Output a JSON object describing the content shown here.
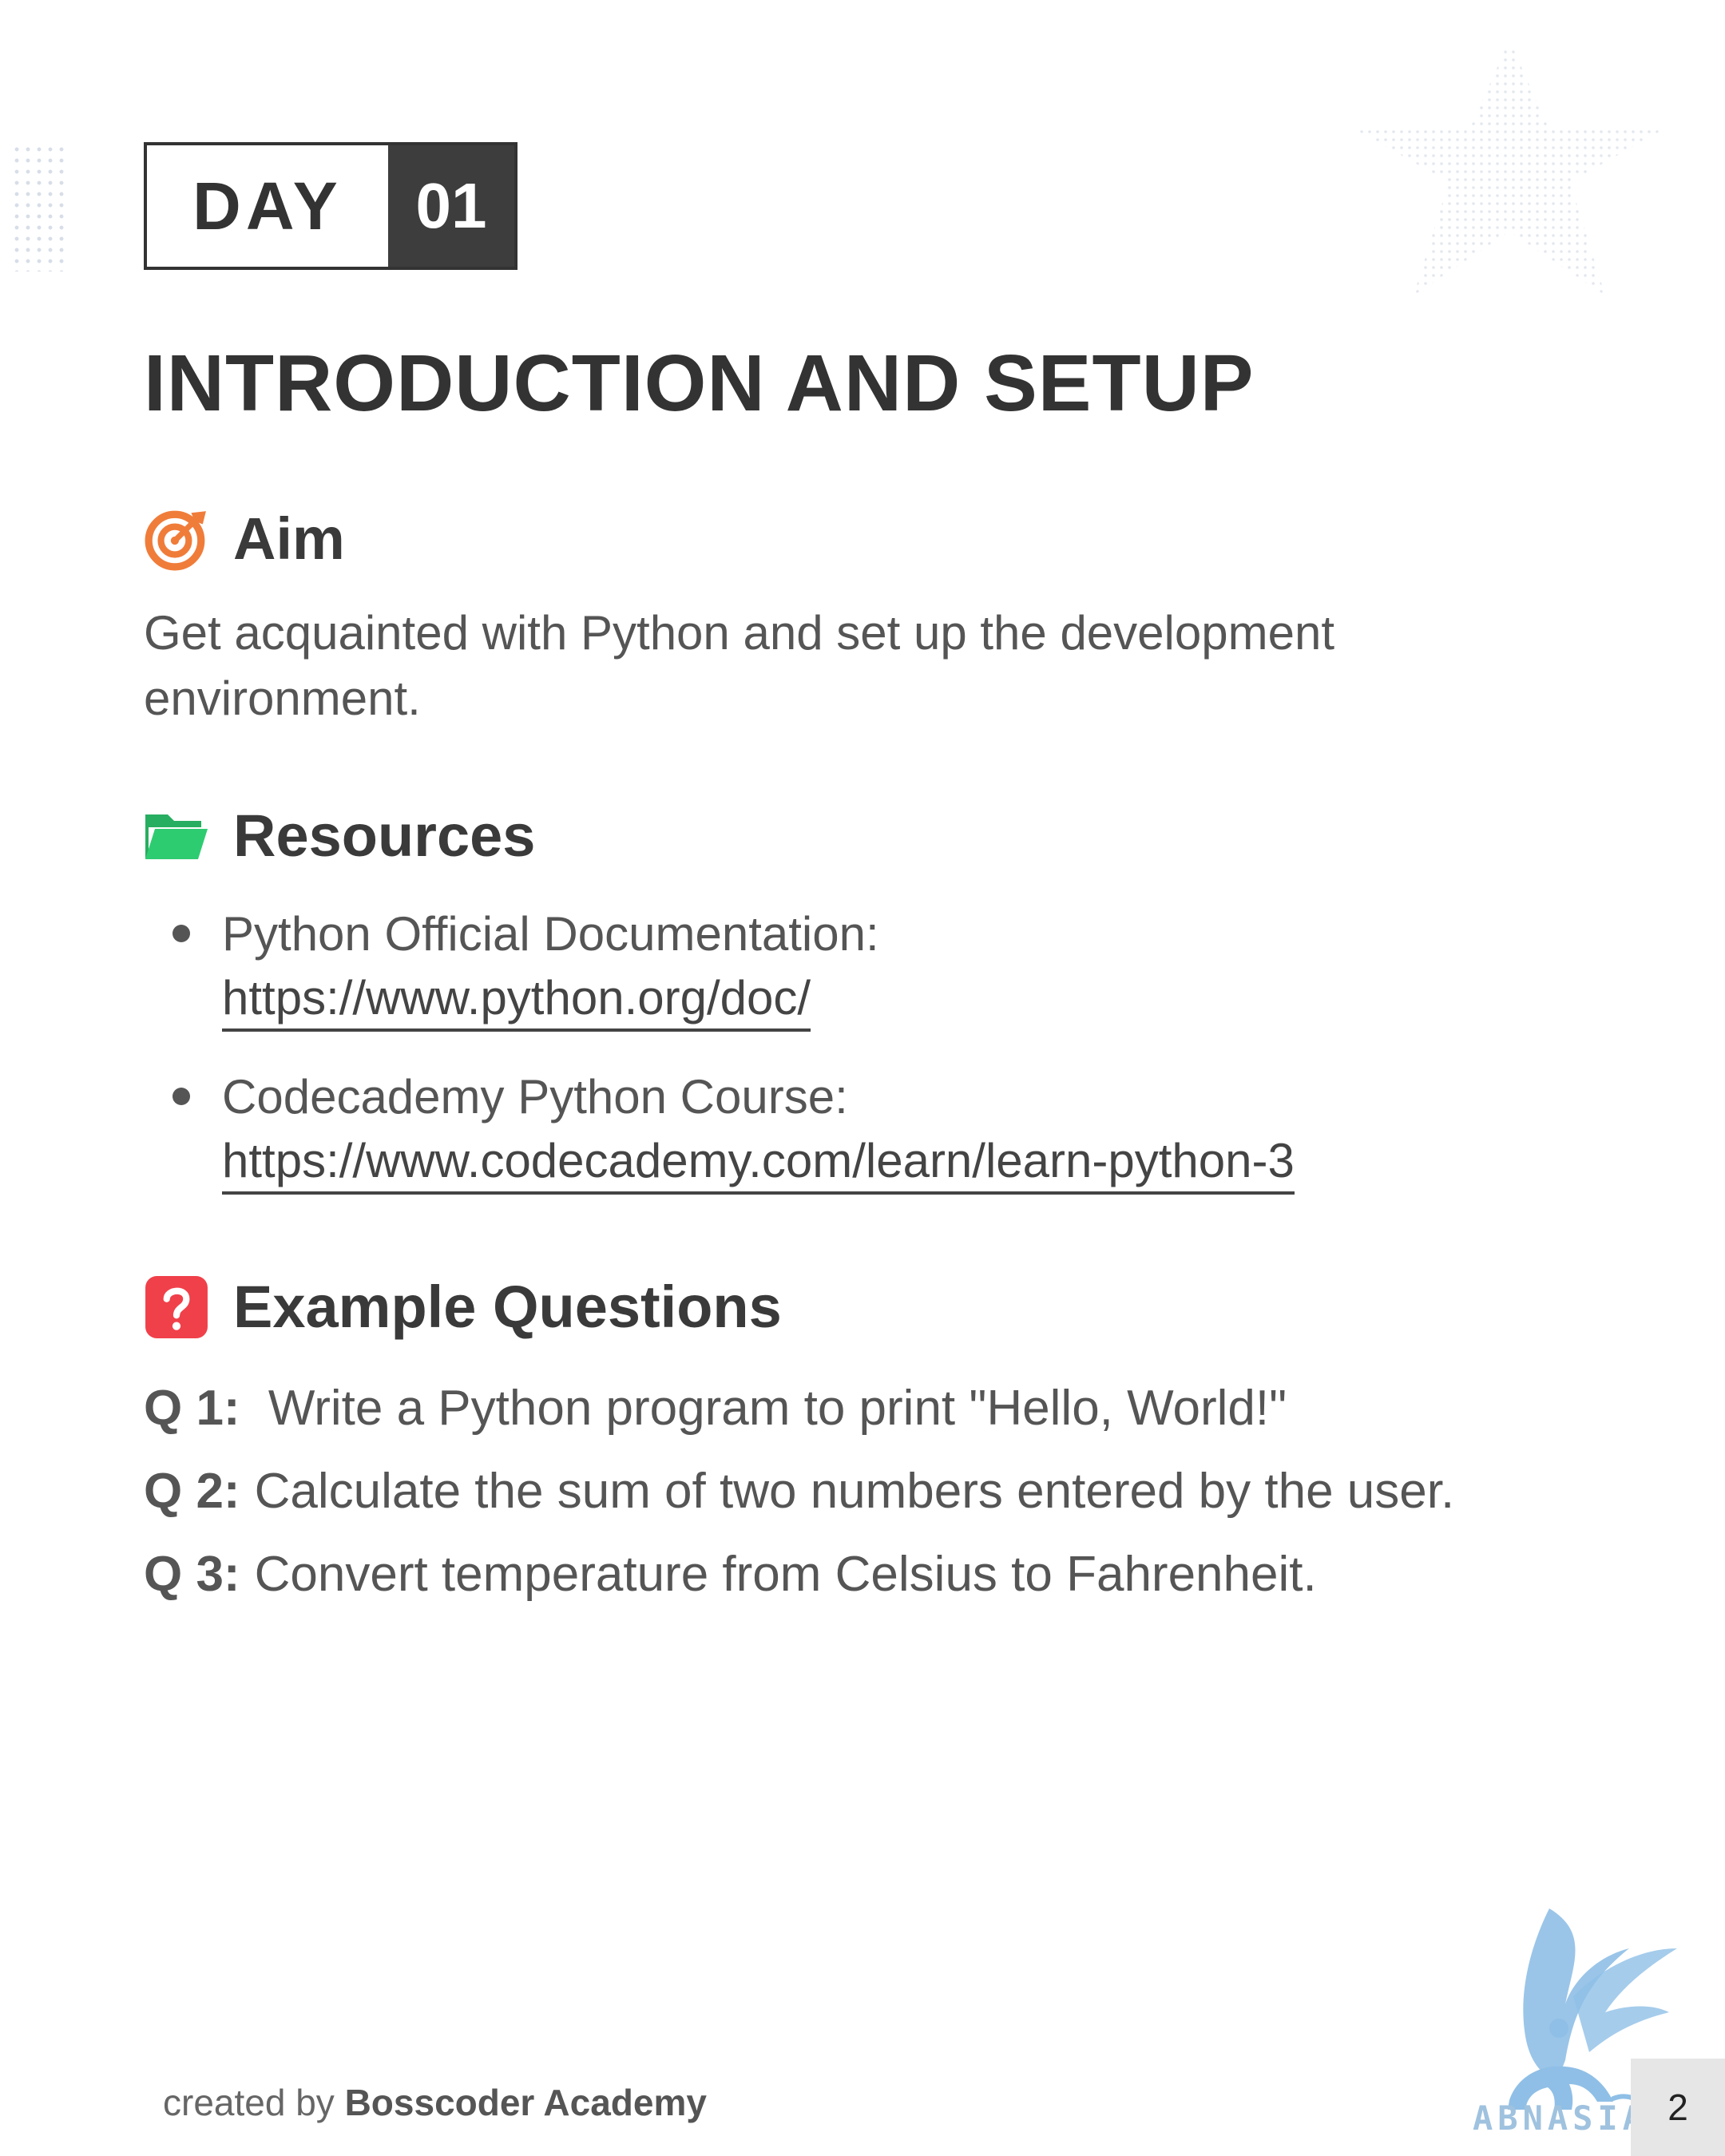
{
  "day_badge": {
    "label": "DAY",
    "number": "01"
  },
  "title": "INTRODUCTION AND SETUP",
  "aim": {
    "icon": "target-icon",
    "heading": "Aim",
    "text": "Get acquainted with Python and set up the development environment."
  },
  "resources": {
    "icon": "folder-icon",
    "heading": "Resources",
    "items": [
      {
        "label": "Python Official Documentation:",
        "url": "https://www.python.org/doc/"
      },
      {
        "label": "Codecademy Python Course:",
        "url": "https://www.codecademy.com/learn/learn-python-3"
      }
    ]
  },
  "questions": {
    "icon": "question-icon",
    "heading": "Example Questions",
    "items": [
      {
        "label": "Q 1:",
        "text": " Write a Python program to print \"Hello, World!\""
      },
      {
        "label": "Q 2:",
        "text": "Calculate the sum of two numbers entered by the user."
      },
      {
        "label": "Q 3:",
        "text": "Convert temperature from Celsius to Fahrenheit."
      }
    ]
  },
  "footer": {
    "prefix": "created by",
    "brand": "Bosscoder Academy"
  },
  "watermark": {
    "text": "ABNASIA.ORG"
  },
  "page_number": "2",
  "colors": {
    "text_dark": "#333333",
    "text_body": "#555555",
    "aim_icon": "#f07c3a",
    "folder_icon": "#2ecc71",
    "question_icon": "#f0404a",
    "watermark": "#8fbfe6"
  }
}
